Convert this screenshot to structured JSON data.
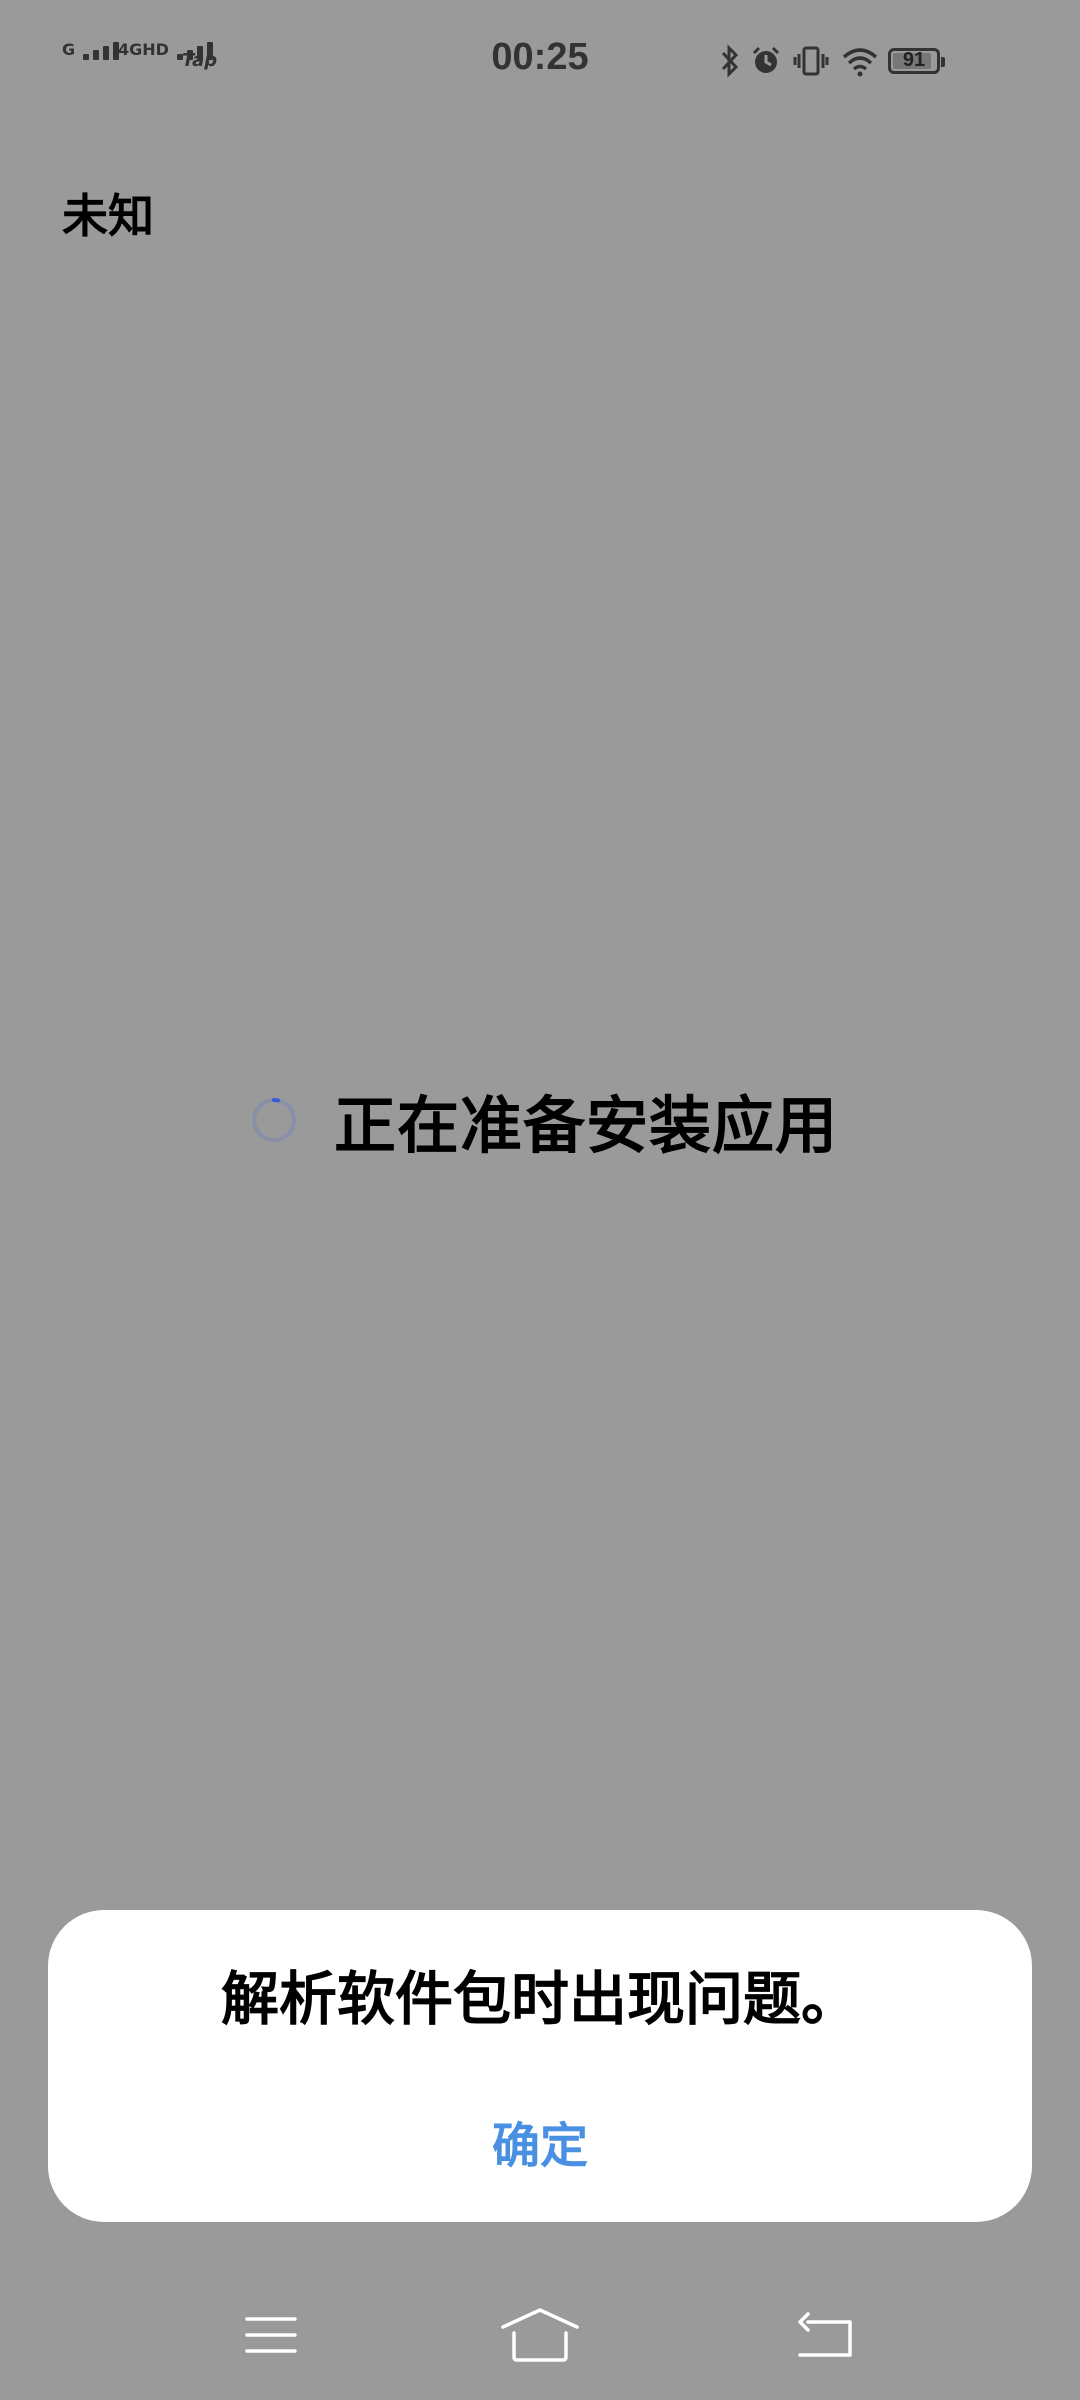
{
  "status_bar": {
    "sim1_label": "G",
    "sim2_label": "4GHD",
    "carrier_icon": "Tap",
    "time": "00:25",
    "icons": [
      "bluetooth-icon",
      "alarm-icon",
      "vibrate-icon",
      "wifi-icon"
    ],
    "battery_percent": "91",
    "battery_level": 0.91
  },
  "app": {
    "title": "未知"
  },
  "progress": {
    "text": "正在准备安装应用"
  },
  "dialog": {
    "message": "解析软件包时出现问题。",
    "confirm_label": "确定"
  },
  "nav_bar": {
    "icons": [
      "menu-icon",
      "home-icon",
      "back-icon"
    ]
  },
  "colors": {
    "overlay_background": "#9a9a9a",
    "dialog_background": "#ffffff",
    "accent": "#4a90e2",
    "spinner_track": "#8a8fa8",
    "spinner_head": "#3a5bd9"
  }
}
